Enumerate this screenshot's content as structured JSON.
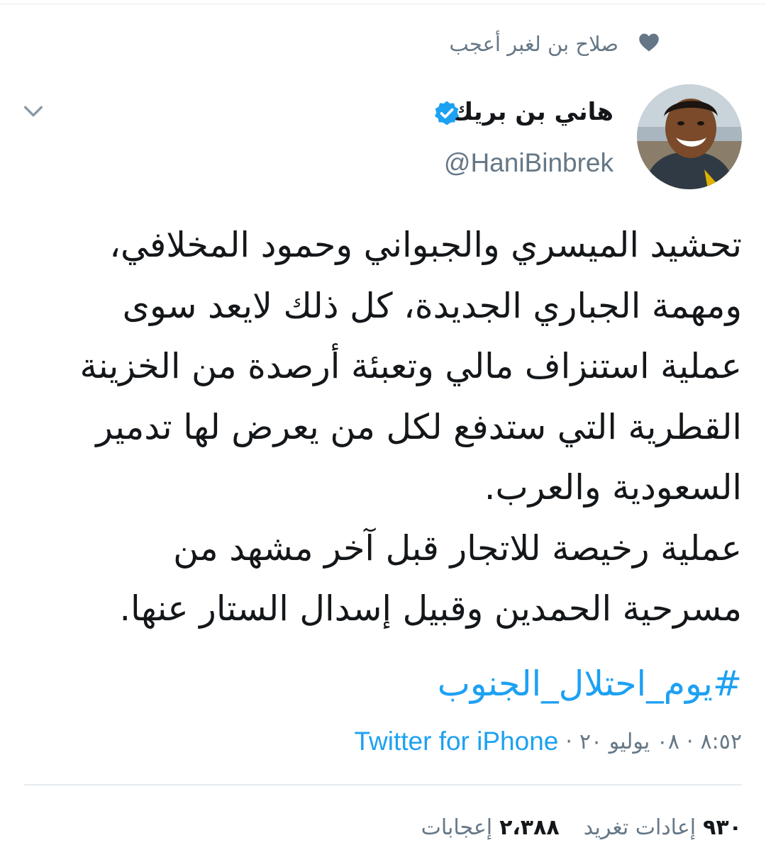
{
  "colors": {
    "accent": "#1da1f2",
    "secondary_text": "#657786",
    "primary_text": "#14171a",
    "divider": "#e6ecf0"
  },
  "social_context": {
    "icon": "heart-icon",
    "text": "صلاح بن لغبر أعجب"
  },
  "author": {
    "display_name": "هاني بن بريك",
    "verified_icon": "verified-badge-icon",
    "handle": "@HaniBinbrek"
  },
  "menu": {
    "icon": "chevron-down-icon"
  },
  "tweet": {
    "lines": [
      "تحشيد الميسري والجبواني وحمود المخلافي،",
      "ومهمة الجباري الجديدة، كل ذلك لايعد سوى",
      "عملية استنزاف مالي وتعبئة أرصدة من الخزينة",
      "القطرية التي ستدفع لكل من يعرض لها تدمير",
      "السعودية والعرب.",
      "عملية رخيصة للاتجار قبل آخر مشهد من",
      "مسرحية الحمدين وقبيل إسدال الستار عنها."
    ],
    "hashtag": "#يوم_احتلال_الجنوب"
  },
  "meta": {
    "time": "٨:٥٢",
    "date": "٠٨ يوليو ٢٠",
    "separator": "·",
    "source": "Twitter for iPhone"
  },
  "stats": {
    "retweets_count": "٩٣٠",
    "retweets_label": "إعادات تغريد",
    "likes_count": "٢،٣٨٨",
    "likes_label": "إعجابات"
  }
}
